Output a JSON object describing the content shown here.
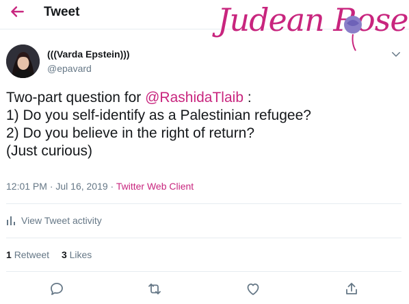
{
  "header": {
    "title": "Tweet",
    "back_icon": "back-arrow-icon"
  },
  "watermark": {
    "text": "Judean Rose"
  },
  "author": {
    "name": "(((Varda Epstein)))",
    "handle": "@epavard"
  },
  "tweet": {
    "line1_prefix": "Two-part question for ",
    "mention": "@RashidaTlaib",
    "line1_suffix": " :",
    "line2": "1) Do you self-identify as a Palestinian refugee?",
    "line3": "2) Do you believe in the right of return?",
    "line4": "(Just curious)"
  },
  "meta": {
    "time": "12:01 PM · Jul 16, 2019 · ",
    "source": "Twitter Web Client"
  },
  "activity": {
    "label": "View Tweet activity"
  },
  "stats": {
    "retweets_count": "1",
    "retweets_label": "Retweet",
    "likes_count": "3",
    "likes_label": "Likes"
  },
  "colors": {
    "accent": "#c8257e",
    "muted": "#657786",
    "text": "#14171a",
    "divider": "#e6ecf0"
  }
}
